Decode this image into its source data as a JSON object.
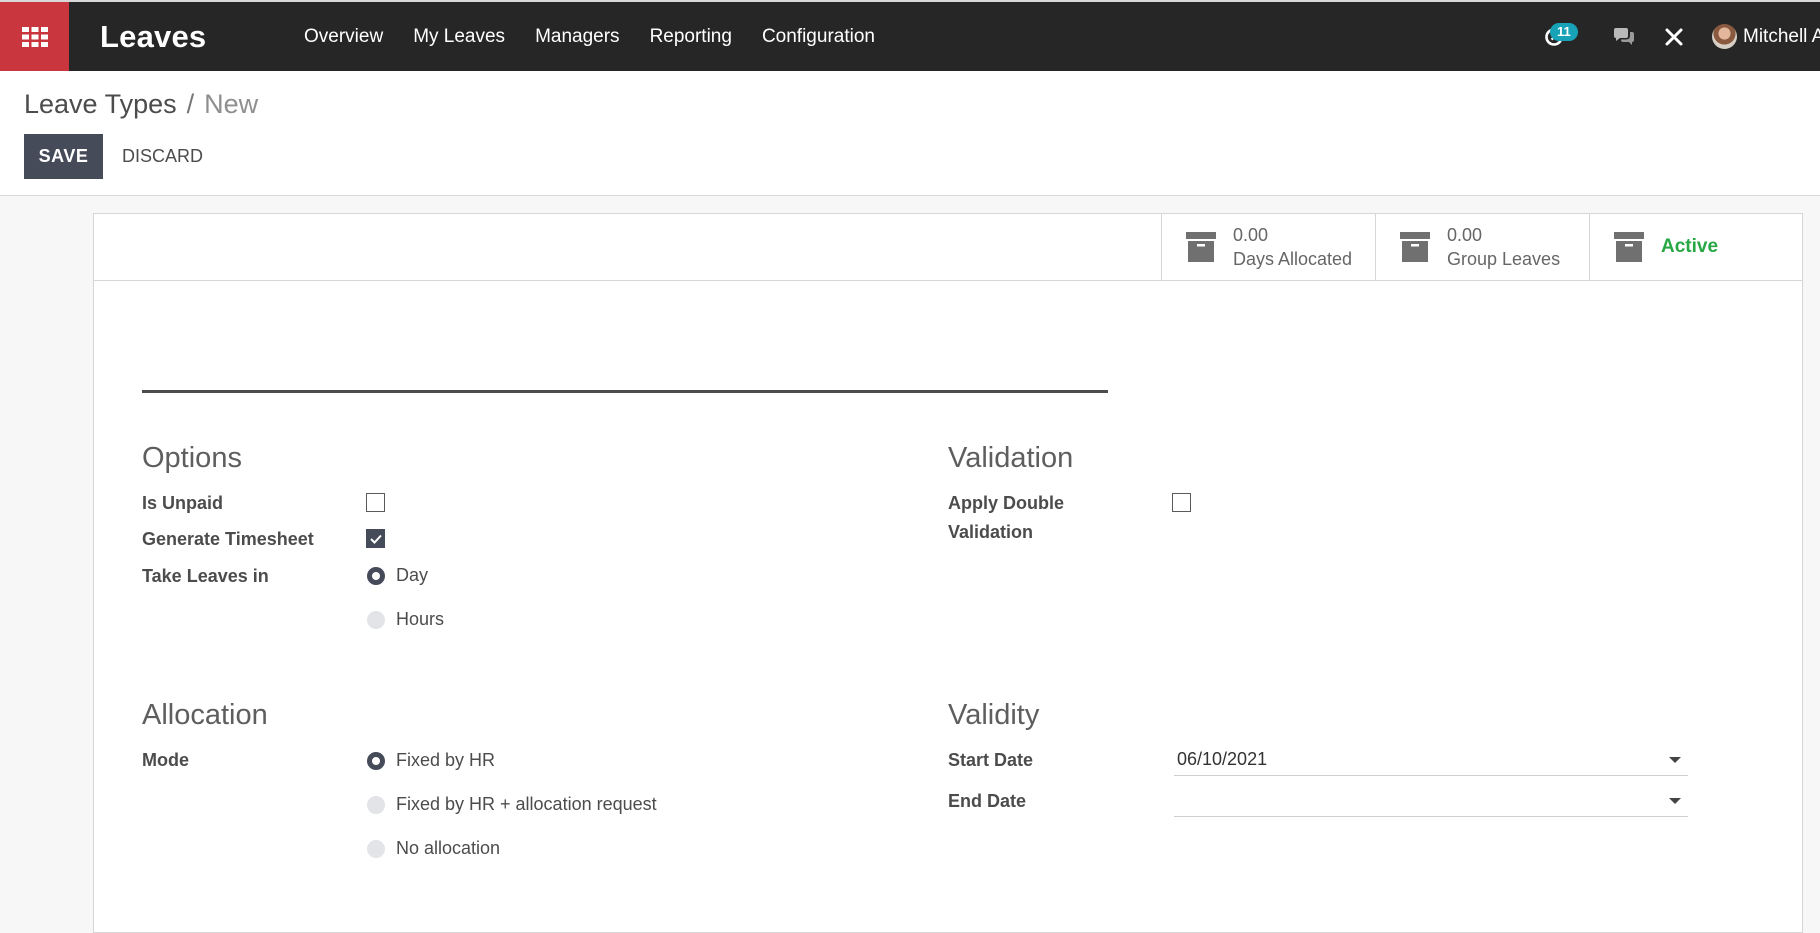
{
  "app": {
    "title": "Leaves",
    "apps_icon": "grid-icon"
  },
  "menu": [
    {
      "label": "Overview"
    },
    {
      "label": "My Leaves"
    },
    {
      "label": "Managers"
    },
    {
      "label": "Reporting"
    },
    {
      "label": "Configuration"
    }
  ],
  "systray": {
    "activity_icon": "clock-icon",
    "activity_count": "11",
    "chat_icon": "chat-icon",
    "debug_icon": "tools-icon",
    "user_name": "Mitchell Admin"
  },
  "breadcrumb": {
    "parent": "Leave Types",
    "separator": "/",
    "current": "New"
  },
  "buttons": {
    "save": "SAVE",
    "discard": "DISCARD"
  },
  "stat_buttons": {
    "days_allocated": {
      "value": "0.00",
      "label": "Days Allocated"
    },
    "group_leaves": {
      "value": "0.00",
      "label": "Group Leaves"
    },
    "active": {
      "label": "Active"
    }
  },
  "name_field": {
    "value": ""
  },
  "options": {
    "title": "Options",
    "is_unpaid": {
      "label": "Is Unpaid",
      "checked": false
    },
    "generate_timesheet": {
      "label": "Generate Timesheet",
      "checked": true
    },
    "take_leaves_in": {
      "label": "Take Leaves in",
      "options": [
        "Day",
        "Hours"
      ],
      "selected": "Day"
    }
  },
  "validation": {
    "title": "Validation",
    "apply_double_validation": {
      "label": "Apply Double Validation",
      "line1": "Apply Double",
      "line2": "Validation",
      "checked": false
    }
  },
  "allocation": {
    "title": "Allocation",
    "mode": {
      "label": "Mode",
      "options": [
        "Fixed by HR",
        "Fixed by HR + allocation request",
        "No allocation"
      ],
      "selected": "Fixed by HR"
    }
  },
  "validity": {
    "title": "Validity",
    "start_date": {
      "label": "Start Date",
      "value": "06/10/2021"
    },
    "end_date": {
      "label": "End Date",
      "value": ""
    }
  },
  "colors": {
    "navbar": "#262626",
    "apps_button": "#c9363d",
    "primary": "#464b5a",
    "badge": "#17a2b8",
    "active_green": "#28a745"
  }
}
